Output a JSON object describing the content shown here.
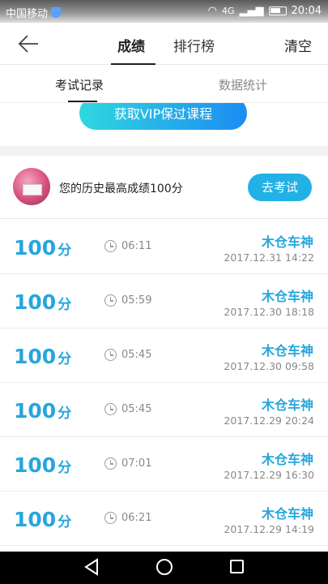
{
  "status_bar": {
    "carrier": "中国移动",
    "network": "4G",
    "time": "20:04"
  },
  "header": {
    "tabs": [
      {
        "label": "成绩",
        "active": true
      },
      {
        "label": "排行榜",
        "active": false
      }
    ],
    "clear_label": "清空",
    "back_icon": "arrow-left-icon"
  },
  "subtabs": [
    {
      "label": "考试记录",
      "active": true
    },
    {
      "label": "数据统计",
      "active": false
    }
  ],
  "vip_button": "获取VIP保过课程",
  "best": {
    "text": "您的历史最高成绩100分",
    "button": "去考试"
  },
  "records": [
    {
      "score": "100",
      "unit": "分",
      "duration": "06:11",
      "name": "木仓车神",
      "date": "2017.12.31  14:22"
    },
    {
      "score": "100",
      "unit": "分",
      "duration": "05:59",
      "name": "木仓车神",
      "date": "2017.12.30  18:18"
    },
    {
      "score": "100",
      "unit": "分",
      "duration": "05:45",
      "name": "木仓车神",
      "date": "2017.12.30  09:58"
    },
    {
      "score": "100",
      "unit": "分",
      "duration": "05:45",
      "name": "木仓车神",
      "date": "2017.12.29  20:24"
    },
    {
      "score": "100",
      "unit": "分",
      "duration": "07:01",
      "name": "木仓车神",
      "date": "2017.12.29  16:30"
    },
    {
      "score": "100",
      "unit": "分",
      "duration": "06:21",
      "name": "木仓车神",
      "date": "2017.12.29  14:19"
    }
  ],
  "colors": {
    "accent": "#26a6dd",
    "button": "#21b1e6"
  }
}
